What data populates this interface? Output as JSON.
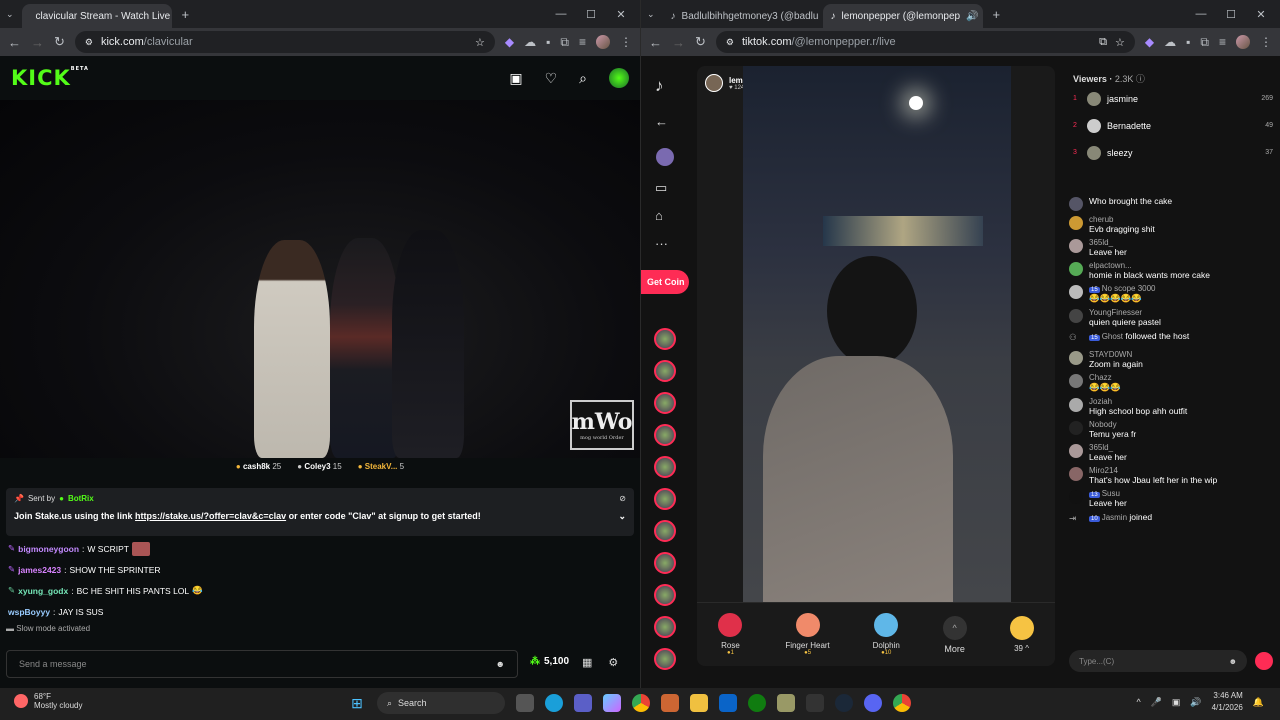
{
  "left": {
    "tab_title": "clavicular Stream - Watch Live o",
    "url_domain": "kick.com",
    "url_path": "/clavicular",
    "logo": "KICK",
    "logo_beta": "BETA",
    "gift_leaders": [
      {
        "name": "cash8k",
        "count": "25"
      },
      {
        "name": "Coley3",
        "count": "15"
      },
      {
        "name": "SteakV...",
        "count": "5"
      }
    ],
    "pinned": {
      "sent_by_label": "Sent by",
      "bot": "BotRix",
      "msg_before": "Join Stake.us using the link",
      "link": "https://stake.us/?offer=clav&c=clav",
      "msg_after": "or enter code \"Clav\" at signup to get started!"
    },
    "chat": [
      {
        "user": "bigmoneygoon",
        "text": "W SCRIPT"
      },
      {
        "user": "james2423",
        "text": "SHOW THE SPRINTER"
      },
      {
        "user": "xyung_godx",
        "text": "BC HE SHIT HIS PANTS LOL"
      },
      {
        "user": "wspBoyyy",
        "text": "JAY IS SUS"
      }
    ],
    "slow_mode": "Slow mode activated",
    "send_placeholder": "Send a message",
    "points": "5,100",
    "watermark": "mWo",
    "watermark_sub": "mog world Order"
  },
  "right": {
    "tab1_title": "Badlulbihhgetmoney3 (@badlu",
    "tab2_title": "lemonpepper (@lemonpep",
    "url_domain": "tiktok.com",
    "url_path": "/@lemonpepper.r/live",
    "get_coins": "Get Coin",
    "host_name": "lemonpepper",
    "host_likes": "124.7K",
    "gifts": [
      {
        "name": "Rose",
        "price": "1",
        "color": "#e0304a"
      },
      {
        "name": "Finger Heart",
        "price": "5",
        "color": "#f08a6a"
      },
      {
        "name": "Dolphin",
        "price": "10",
        "color": "#5fb7e8"
      }
    ],
    "more_label": "More",
    "coin_count": "39",
    "viewers_label": "Viewers",
    "viewers_count": "2.3K",
    "top_viewers": [
      {
        "rank": "1",
        "name": "jasmine",
        "score": "269"
      },
      {
        "rank": "2",
        "name": "Bernadette",
        "score": "49"
      },
      {
        "rank": "3",
        "name": "sleezy",
        "score": "37"
      }
    ],
    "chat": [
      {
        "user": "",
        "text": "Who brought the cake"
      },
      {
        "user": "cherub",
        "text": "Evb dragging shit"
      },
      {
        "user": "365ld_",
        "text": "Leave her"
      },
      {
        "user": "elpactown...",
        "text": "homie in black wants more cake"
      },
      {
        "user": "No scope 3000",
        "text": "😂😂😂😂😂"
      },
      {
        "user": "YoungFinesser",
        "text": "quien quiere pastel"
      },
      {
        "user": "Ghost",
        "text": "followed the host"
      },
      {
        "user": "STAYD0WN",
        "text": "Zoom in again"
      },
      {
        "user": "Chazz",
        "text": "😂😂😂"
      },
      {
        "user": "Joziah",
        "text": "High school bop ahh outfit"
      },
      {
        "user": "Nobody",
        "text": "Temu yera fr"
      },
      {
        "user": "365ld_",
        "text": "Leave her"
      },
      {
        "user": "Miro214",
        "text": "That's how Jbau left her in the wip"
      },
      {
        "user": "Susu",
        "text": "Leave her"
      },
      {
        "user": "Jasmin",
        "text": "joined"
      }
    ],
    "type_placeholder": "Type...(C)"
  },
  "taskbar": {
    "temp": "68°F",
    "weather": "Mostly cloudy",
    "search": "Search",
    "time": "3:46 AM",
    "date": "4/1/2026"
  }
}
